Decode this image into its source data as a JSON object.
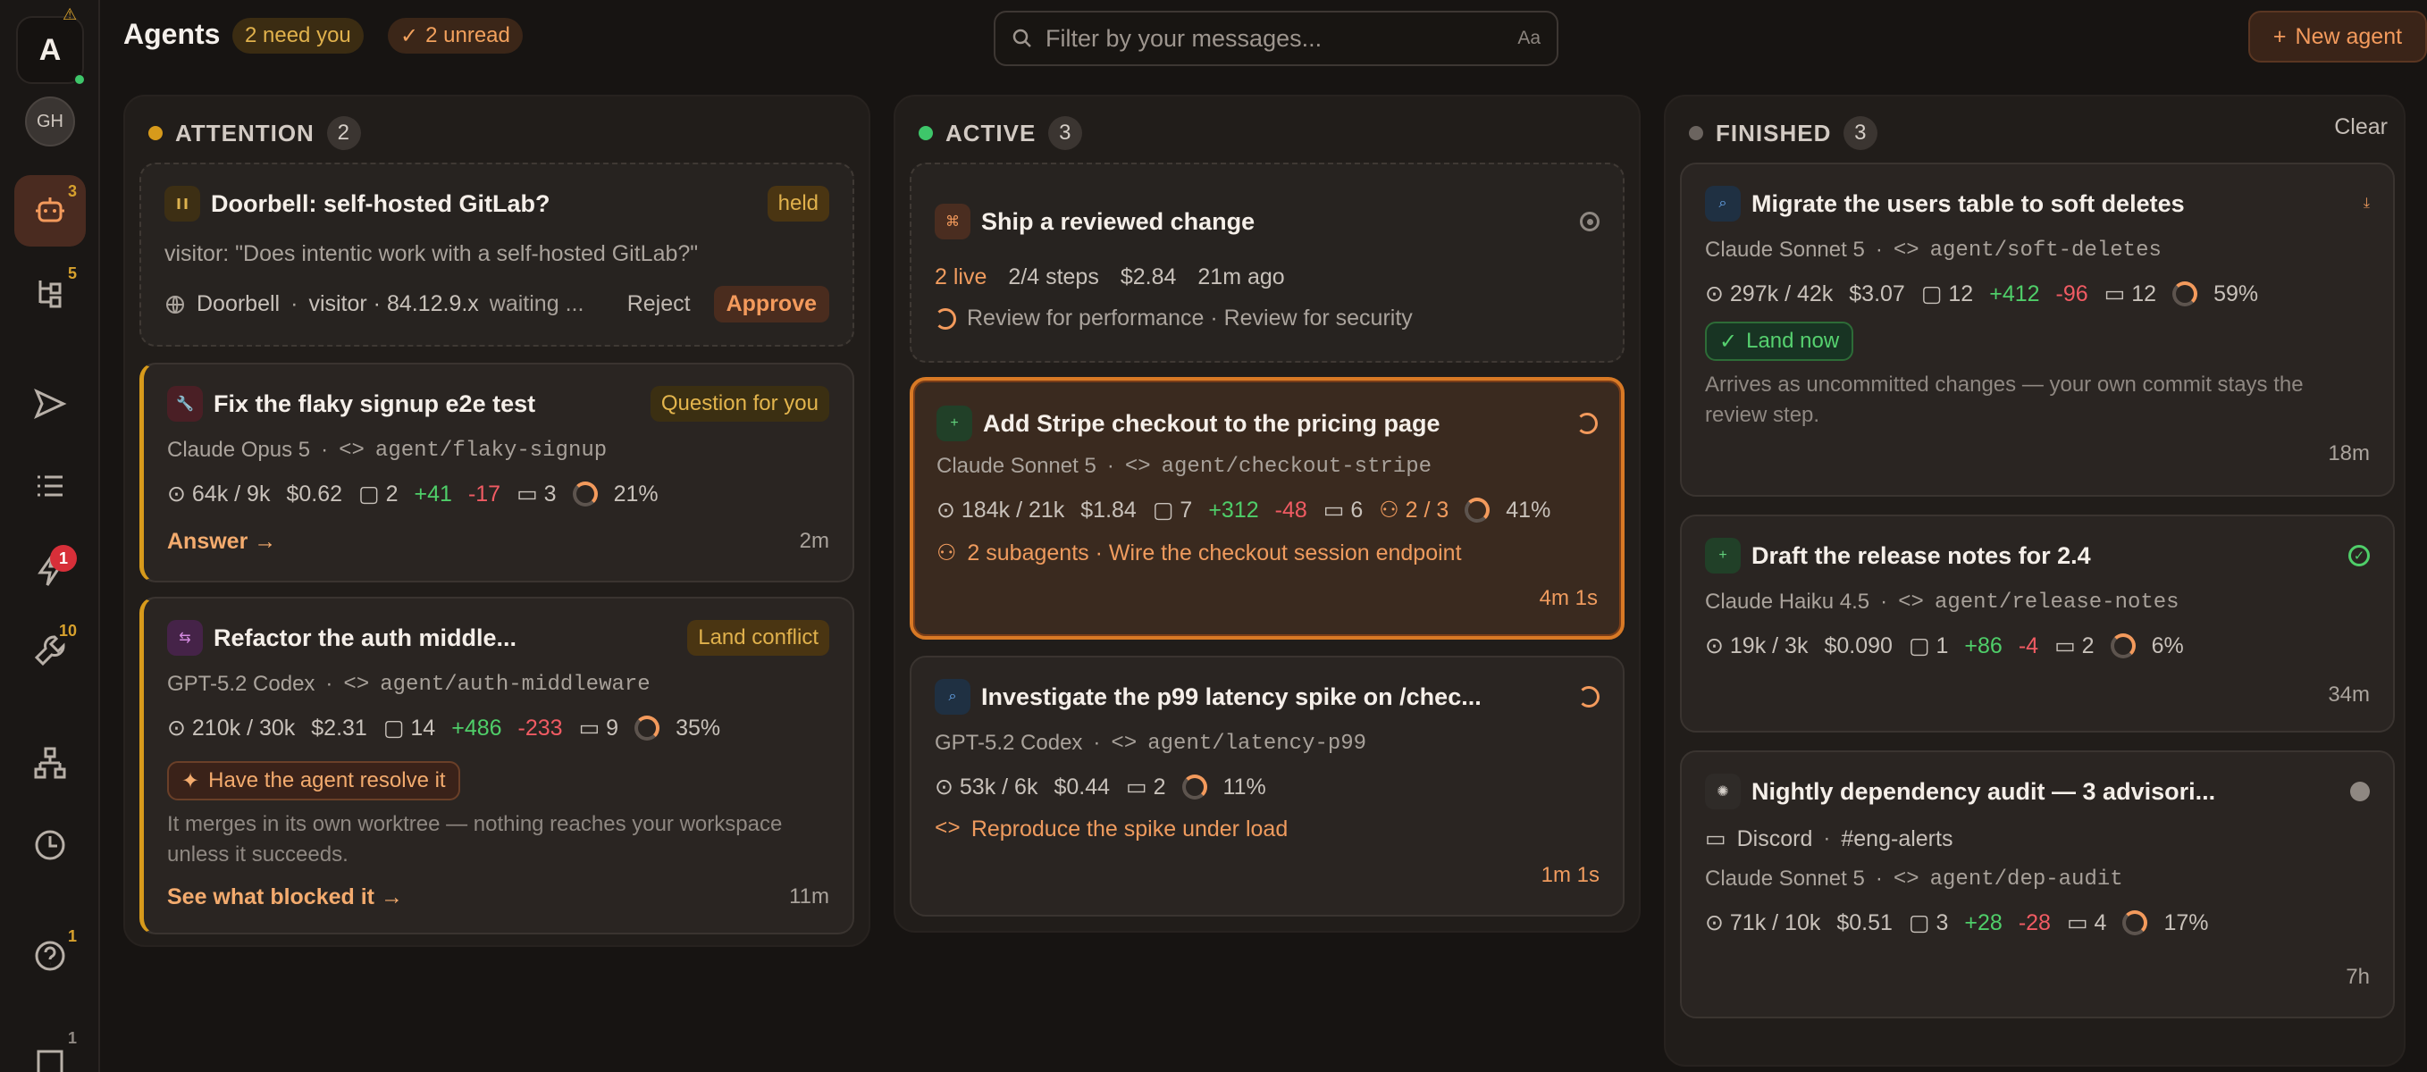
{
  "rail": {
    "logo": "A",
    "avatar": "GH",
    "badges": [
      "3",
      "5",
      "1",
      "10",
      "1",
      "1"
    ]
  },
  "header": {
    "title": "Agents",
    "need_you": "2 need you",
    "unread": "2 unread",
    "search_placeholder": "Filter by your messages...",
    "aa": "Aa",
    "new_agent": "New agent"
  },
  "columns": {
    "attention": {
      "label": "ATTENTION",
      "count": "2"
    },
    "active": {
      "label": "ACTIVE",
      "count": "3"
    },
    "finished": {
      "label": "FINISHED",
      "count": "3",
      "clear": "Clear"
    }
  },
  "attention": {
    "doorbell": {
      "title": "Doorbell: self-hosted GitLab?",
      "tag": "held",
      "message": "visitor: \"Does intentic work with a self-hosted GitLab?\"",
      "source": "Doorbell",
      "meta": "visitor · 84.12.9.x",
      "status": "waiting ...",
      "reject": "Reject",
      "approve": "Approve"
    },
    "flaky": {
      "title": "Fix the flaky signup e2e test",
      "tag": "Question for you",
      "model": "Claude Opus 5",
      "branch": "agent/flaky-signup",
      "tokens": "64k / 9k",
      "cost": "$0.62",
      "files": "2",
      "add": "+41",
      "del": "-17",
      "comments": "3",
      "context": "21%",
      "action": "Answer →",
      "time": "2m"
    },
    "auth": {
      "title": "Refactor the auth middle...",
      "tag": "Land conflict",
      "model": "GPT-5.2 Codex",
      "branch": "agent/auth-middleware",
      "tokens": "210k / 30k",
      "cost": "$2.31",
      "files": "14",
      "add": "+486",
      "del": "-233",
      "comments": "9",
      "context": "35%",
      "resolve": "Have the agent resolve it",
      "note": "It merges in its own worktree — nothing reaches your workspace unless it succeeds.",
      "action": "See what blocked it →",
      "time": "11m"
    }
  },
  "active": {
    "ship": {
      "title": "Ship a reviewed change",
      "live": "2 live",
      "steps": "2/4 steps",
      "cost": "$2.84",
      "ago": "21m ago",
      "reviews": "Review for performance · Review for security"
    },
    "stripe": {
      "title": "Add Stripe checkout to the pricing page",
      "model": "Claude Sonnet 5",
      "branch": "agent/checkout-stripe",
      "tokens": "184k / 21k",
      "cost": "$1.84",
      "files": "7",
      "add": "+312",
      "del": "-48",
      "comments": "6",
      "subagents": "2 / 3",
      "context": "41%",
      "subtask": "2 subagents · Wire the checkout session endpoint",
      "time": "4m 1s"
    },
    "latency": {
      "title": "Investigate the p99 latency spike on /chec...",
      "model": "GPT-5.2 Codex",
      "branch": "agent/latency-p99",
      "tokens": "53k / 6k",
      "cost": "$0.44",
      "comments": "2",
      "context": "11%",
      "subtask": "Reproduce the spike under load",
      "time": "1m 1s"
    }
  },
  "finished": {
    "soft": {
      "title": "Migrate the users table to soft deletes",
      "model": "Claude Sonnet 5",
      "branch": "agent/soft-deletes",
      "tokens": "297k / 42k",
      "cost": "$3.07",
      "files": "12",
      "add": "+412",
      "del": "-96",
      "comments": "12",
      "context": "59%",
      "land": "Land now",
      "note": "Arrives as uncommitted changes — your own commit stays the review step.",
      "time": "18m"
    },
    "release": {
      "title": "Draft the release notes for 2.4",
      "model": "Claude Haiku 4.5",
      "branch": "agent/release-notes",
      "tokens": "19k / 3k",
      "cost": "$0.090",
      "files": "1",
      "add": "+86",
      "del": "-4",
      "comments": "2",
      "context": "6%",
      "time": "34m"
    },
    "audit": {
      "title": "Nightly dependency audit — 3 advisori...",
      "source": "Discord",
      "channel": "#eng-alerts",
      "model": "Claude Sonnet 5",
      "branch": "agent/dep-audit",
      "tokens": "71k / 10k",
      "cost": "$0.51",
      "files": "3",
      "add": "+28",
      "del": "-28",
      "comments": "4",
      "context": "17%",
      "time": "7h"
    }
  },
  "colors": {
    "bg": "#171412",
    "accent": "#f39a5c",
    "attention": "#d79a1b",
    "active": "#3ec66a",
    "finished": "#6b645f"
  },
  "icons": [
    "warning-icon",
    "robot-icon",
    "tree-icon",
    "send-icon",
    "list-icon",
    "lightning-icon",
    "wrench-icon",
    "workflow-icon",
    "clock-icon",
    "help-icon",
    "square-icon",
    "search-icon",
    "plus-icon",
    "check-icon",
    "pause-icon",
    "wrench-icon",
    "swap-icon",
    "globe-icon",
    "workflow-icon",
    "spinner-icon",
    "download-icon",
    "sparkle-icon",
    "discord-icon",
    "sunburst-icon"
  ]
}
